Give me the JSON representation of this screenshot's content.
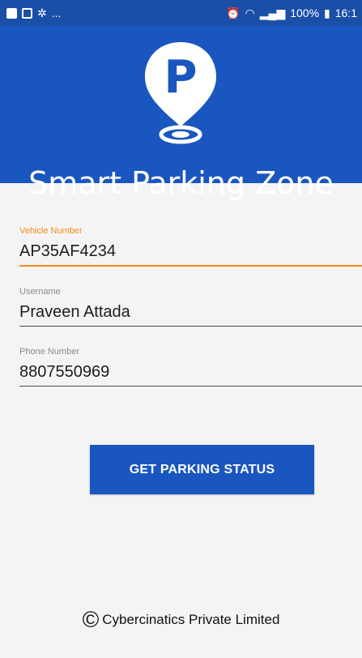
{
  "status_bar": {
    "left_icons": [
      "notification-square-icon",
      "image-icon",
      "sync-icon"
    ],
    "ellipsis": "...",
    "battery": "100%",
    "time": "16:1"
  },
  "header": {
    "app_title": "Smart Parking Zone",
    "logo_letter": "P",
    "background_color": "#1a56bf"
  },
  "form": {
    "vehicle_number": {
      "label": "Vehicle Number",
      "value": "AP35AF4234",
      "focused": true
    },
    "username": {
      "label": "Username",
      "value": "Praveen Attada"
    },
    "phone_number": {
      "label": "Phone Number",
      "value": "8807550969"
    }
  },
  "actions": {
    "get_status_label": "GET PARKING STATUS"
  },
  "footer": {
    "copyright_symbol": "©",
    "company": "Cybercinatics Private Limited"
  },
  "colors": {
    "accent": "#f28a1e",
    "primary": "#1a56bf",
    "status_bar": "#1a4fa8"
  }
}
